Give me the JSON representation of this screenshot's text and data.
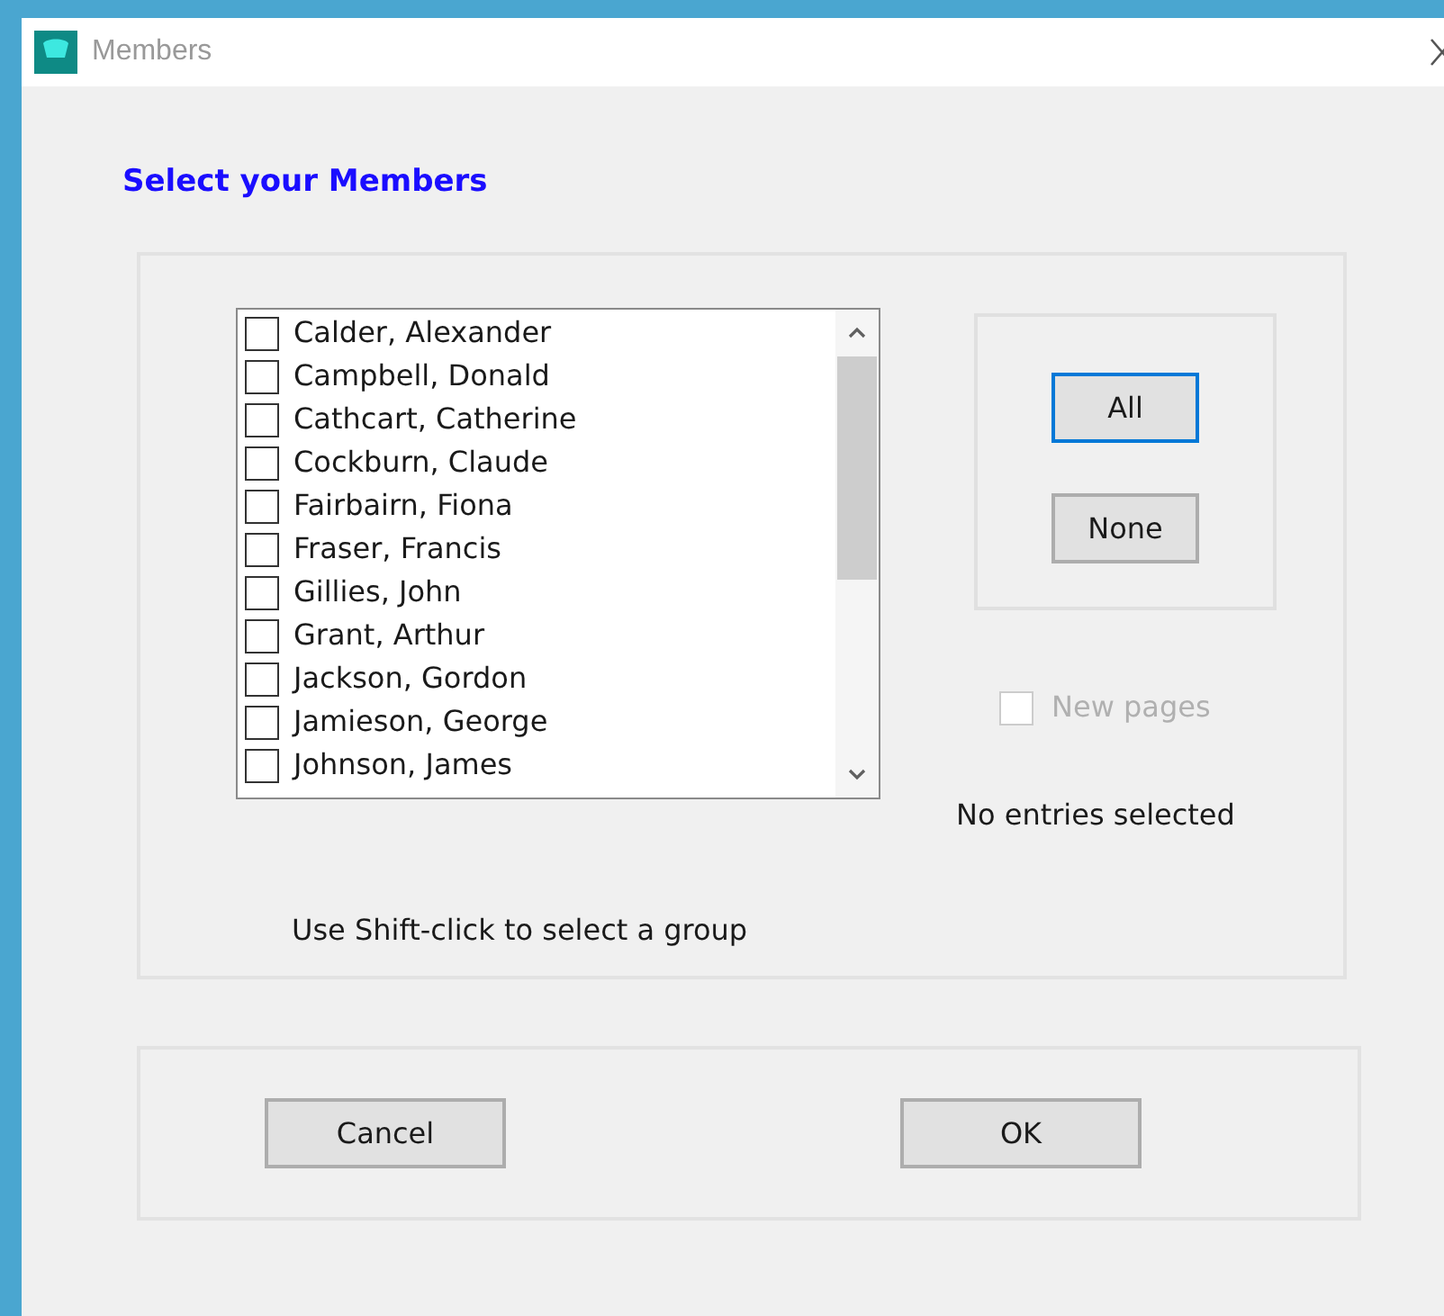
{
  "window": {
    "title": "Members"
  },
  "heading": "Select your Members",
  "members": [
    {
      "name": "Calder, Alexander",
      "checked": false
    },
    {
      "name": "Campbell, Donald",
      "checked": false
    },
    {
      "name": "Cathcart, Catherine",
      "checked": false
    },
    {
      "name": "Cockburn, Claude",
      "checked": false
    },
    {
      "name": "Fairbairn, Fiona",
      "checked": false
    },
    {
      "name": "Fraser, Francis",
      "checked": false
    },
    {
      "name": "Gillies, John",
      "checked": false
    },
    {
      "name": "Grant, Arthur",
      "checked": false
    },
    {
      "name": "Jackson, Gordon",
      "checked": false
    },
    {
      "name": "Jamieson, George",
      "checked": false
    },
    {
      "name": "Johnson, James",
      "checked": false
    }
  ],
  "select_buttons": [
    {
      "label": "All",
      "focused": true
    },
    {
      "label": "None",
      "focused": false
    }
  ],
  "new_pages": {
    "label": "New pages",
    "checked": false,
    "disabled": true
  },
  "status": "No entries selected",
  "hint": "Use Shift-click to select a group",
  "footer_buttons": [
    {
      "label": "Cancel"
    },
    {
      "label": "OK"
    }
  ]
}
